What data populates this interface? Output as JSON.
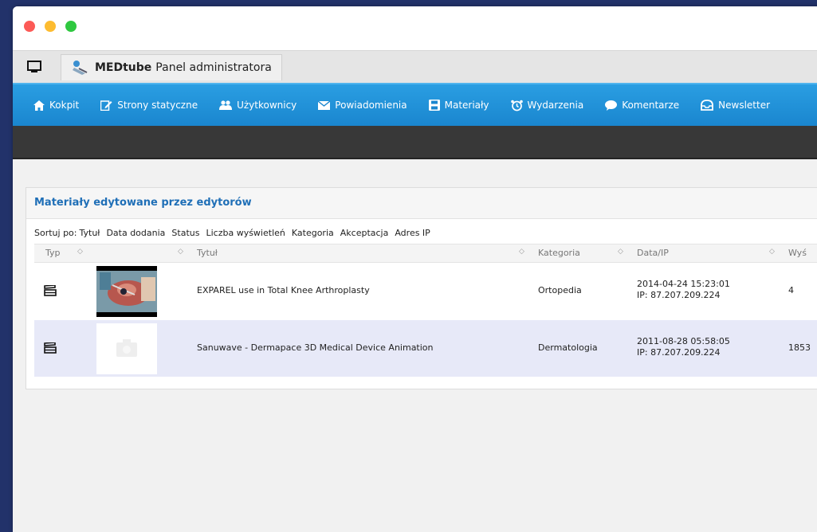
{
  "window": {
    "tab_brand": "MEDtube",
    "tab_title": "Panel administratora"
  },
  "nav": {
    "items": [
      {
        "label": "Kokpit",
        "icon": "home-icon"
      },
      {
        "label": "Strony statyczne",
        "icon": "edit-icon"
      },
      {
        "label": "Użytkownicy",
        "icon": "users-icon"
      },
      {
        "label": "Powiadomienia",
        "icon": "envelope-icon"
      },
      {
        "label": "Materiały",
        "icon": "save-icon"
      },
      {
        "label": "Wydarzenia",
        "icon": "alarm-clock-icon"
      },
      {
        "label": "Komentarze",
        "icon": "speech-bubble-icon"
      },
      {
        "label": "Newsletter",
        "icon": "inbox-icon"
      }
    ]
  },
  "panel": {
    "title": "Materiały edytowane przez edytorów",
    "sort_label": "Sortuj po:",
    "sort_options": [
      "Tytuł",
      "Data dodania",
      "Status",
      "Liczba wyświetleń",
      "Kategoria",
      "Akceptacja",
      "Adres IP"
    ],
    "columns": {
      "type": "Typ",
      "title": "Tytuł",
      "category": "Kategoria",
      "date_ip": "Data/IP",
      "views": "Wyś"
    },
    "rows": [
      {
        "title": "EXPAREL use in Total Knee Arthroplasty",
        "category": "Ortopedia",
        "date": "2014-04-24 15:23:01",
        "ip": "IP: 87.207.209.224",
        "views": "4",
        "thumbnail": "video-thumbnail-surgery"
      },
      {
        "title": "Sanuwave - Dermapace 3D Medical Device Animation",
        "category": "Dermatologia",
        "date": "2011-08-28 05:58:05",
        "ip": "IP: 87.207.209.224",
        "views": "1853",
        "thumbnail": "placeholder-camera"
      }
    ]
  },
  "colors": {
    "nav_blue": "#1a86cf",
    "title_blue": "#1f6fb7",
    "selected_row": "#e7e9f8",
    "background_navy": "#22326a"
  }
}
